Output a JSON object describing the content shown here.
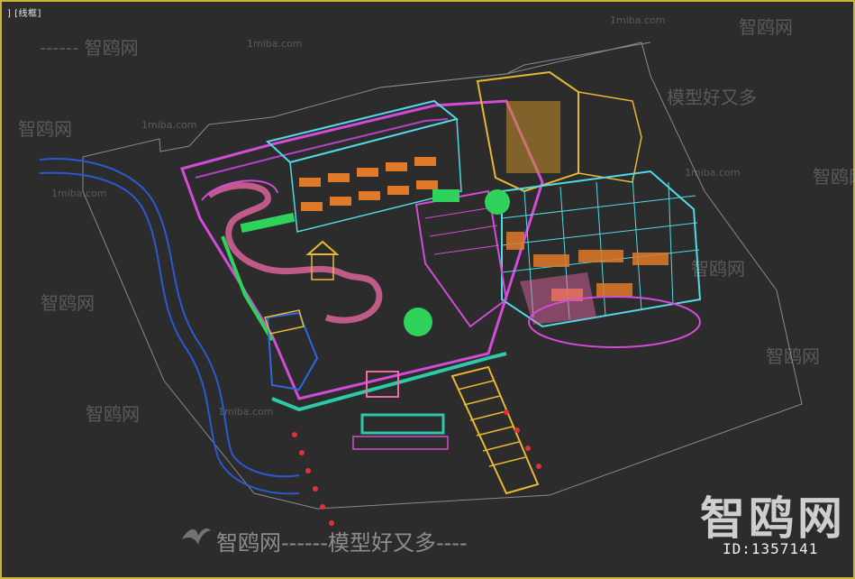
{
  "viewport": {
    "label": "] [线框]",
    "border_color": "#c9b437",
    "background": "#2c2c2c"
  },
  "watermarks": {
    "site_name": "智鸥网",
    "dash_left": "------",
    "dash_right": "-------",
    "slogan": "模型好又多",
    "domain": "1miba.com",
    "bottom_line": "智鸥网------模型好又多----"
  },
  "branding": {
    "logo_text": "智鸥网",
    "id_text": "ID:1357141",
    "bird_icon": "seagull-icon"
  },
  "colors": {
    "magenta": "#d24cd8",
    "cyan": "#52d9e6",
    "orange": "#e07a2a",
    "yellow": "#e8b830",
    "green": "#2fd25a",
    "pink": "#f06aa8",
    "blue": "#2a6ae0",
    "teal": "#2ec9a8",
    "red": "#e0303a",
    "grey_line": "#9a9a9a"
  }
}
